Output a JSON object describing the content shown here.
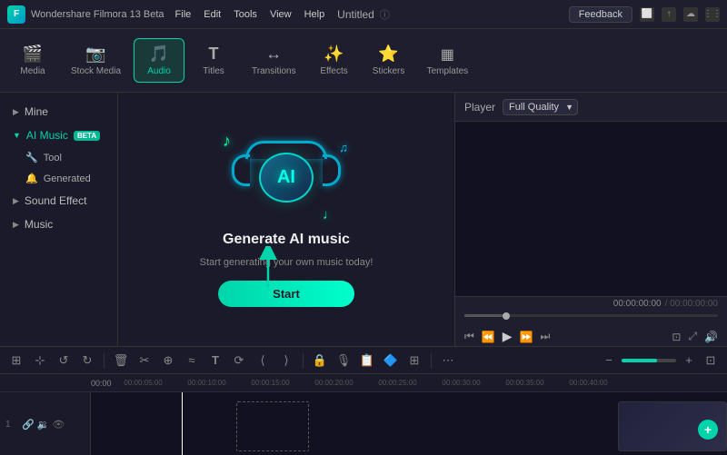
{
  "titleBar": {
    "appName": "Wondershare Filmora 13 Beta",
    "menus": [
      "File",
      "Edit",
      "Tools",
      "View",
      "Help"
    ],
    "projectName": "Untitled",
    "feedbackBtn": "Feedback"
  },
  "toolbar": {
    "items": [
      {
        "id": "media",
        "label": "Media",
        "icon": "🎬"
      },
      {
        "id": "stock-media",
        "label": "Stock Media",
        "icon": "📷"
      },
      {
        "id": "audio",
        "label": "Audio",
        "icon": "🎵",
        "active": true
      },
      {
        "id": "titles",
        "label": "Titles",
        "icon": "T"
      },
      {
        "id": "transitions",
        "label": "Transitions",
        "icon": "↔"
      },
      {
        "id": "effects",
        "label": "Effects",
        "icon": "✨"
      },
      {
        "id": "stickers",
        "label": "Stickers",
        "icon": "⭐"
      },
      {
        "id": "templates",
        "label": "Templates",
        "icon": "▦"
      }
    ]
  },
  "sidebar": {
    "items": [
      {
        "id": "mine",
        "label": "Mine",
        "type": "item"
      },
      {
        "id": "ai-music",
        "label": "AI Music",
        "type": "expanded",
        "badge": "BETA"
      },
      {
        "id": "tool",
        "label": "Tool",
        "type": "sub"
      },
      {
        "id": "generated",
        "label": "Generated",
        "type": "sub"
      },
      {
        "id": "sound-effect",
        "label": "Sound Effect",
        "type": "item"
      },
      {
        "id": "music",
        "label": "Music",
        "type": "item"
      }
    ]
  },
  "aiMusic": {
    "title": "Generate AI music",
    "subtitle": "Start generating your own music today!",
    "startBtn": "Start"
  },
  "player": {
    "label": "Player",
    "quality": "Full Quality",
    "timeCode": "00:00:00:00",
    "totalTime": "/ 00:00:00:00"
  },
  "timeline": {
    "marks": [
      "00:00:05:00",
      "00:00:10:00",
      "00:00:15:00",
      "00:00:20:00",
      "00:00:25:00",
      "00:00:30:00",
      "00:00:35:00",
      "00:00:40:00"
    ],
    "track": {
      "id": "1"
    }
  },
  "bottomToolbar": {
    "tools": [
      "⊞",
      "⊹",
      "↺",
      "↻",
      "🗑",
      "✂",
      "⊕",
      "≈",
      "T",
      "⟳",
      "⟨",
      "⟩"
    ],
    "zoom": "65"
  }
}
